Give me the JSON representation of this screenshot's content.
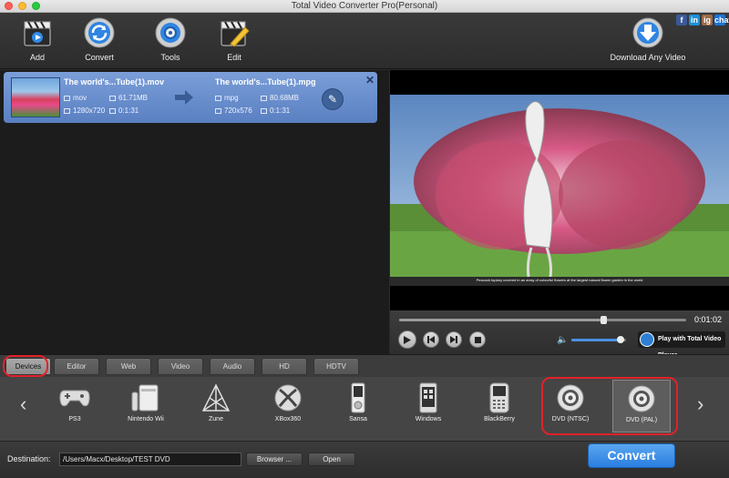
{
  "window": {
    "title": "Total Video Converter Pro(Personal)"
  },
  "toolbar": {
    "add_label": "Add",
    "convert_label": "Convert",
    "tools_label": "Tools",
    "edit_label": "Edit",
    "download_label": "Download Any Video",
    "social": [
      "f",
      "in",
      "ig",
      "chat"
    ]
  },
  "file": {
    "source": {
      "name": "The world's...Tube(1).mov",
      "format": "mov",
      "size": "61.71MB",
      "resolution": "1280x720",
      "duration": "0:1:31"
    },
    "target": {
      "name": "The world's...Tube(1).mpg",
      "format": "mpg",
      "size": "80.68MB",
      "resolution": "720x576",
      "duration": "0:1:31"
    }
  },
  "preview": {
    "caption": "Peacock topiary covered in an array of colourful flowers at the largest natural flower garden in the world",
    "time": "0:01:02",
    "progress_fraction": 0.71,
    "volume_fraction": 0.9,
    "play_with_label": "Play with Total Video Player"
  },
  "tabs": [
    {
      "label": "Devices",
      "active": true
    },
    {
      "label": "Editor"
    },
    {
      "label": "Web"
    },
    {
      "label": "Video"
    },
    {
      "label": "Audio"
    },
    {
      "label": "HD"
    },
    {
      "label": "HDTV"
    }
  ],
  "devices": [
    {
      "label": "PS3",
      "icon": "gamepad-icon"
    },
    {
      "label": "Nintendo Wii",
      "icon": "wii-icon"
    },
    {
      "label": "Zune",
      "icon": "zune-icon"
    },
    {
      "label": "XBox360",
      "icon": "xbox-icon"
    },
    {
      "label": "Sansa",
      "icon": "sansa-icon"
    },
    {
      "label": "Windows",
      "icon": "windows-phone-icon"
    },
    {
      "label": "BlackBerry",
      "icon": "blackberry-icon"
    },
    {
      "label": "DVD (NTSC)",
      "icon": "dvd-icon"
    },
    {
      "label": "DVD (PAL)",
      "icon": "dvd-icon",
      "selected": true
    }
  ],
  "destination": {
    "label": "Destination:",
    "path": "/Users/Macx/Desktop/TEST DVD",
    "browse_label": "Browser ...",
    "open_label": "Open"
  },
  "convert_button": "Convert",
  "colors": {
    "accent": "#2b7ee0",
    "highlight_ring": "#e0222a",
    "file_item": "#6a8fcc"
  }
}
